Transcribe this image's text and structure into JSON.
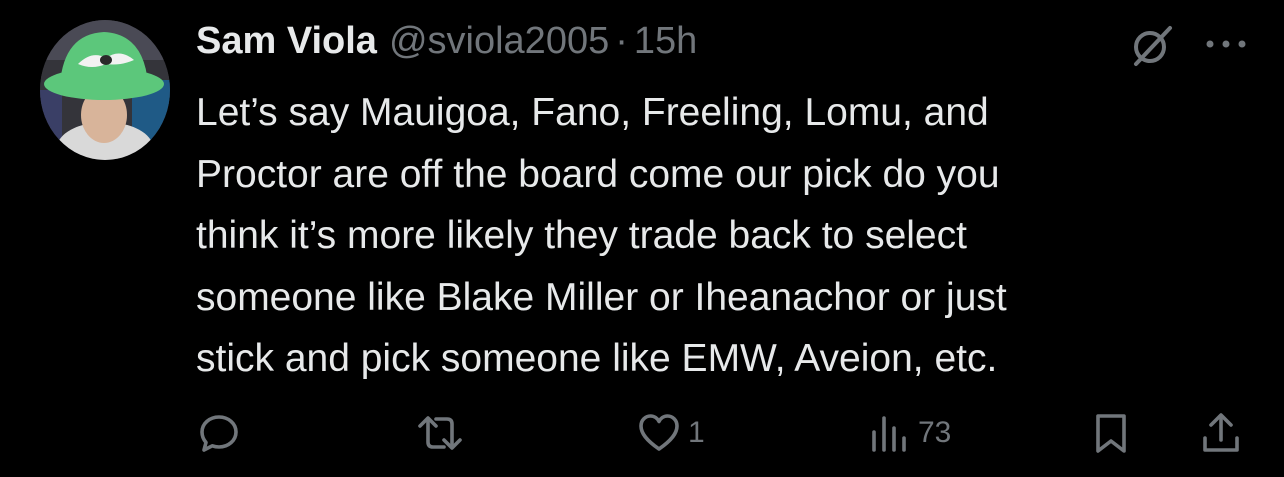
{
  "tweet": {
    "display_name": "Sam Viola",
    "handle": "@sviola2005",
    "separator": "·",
    "time": "15h",
    "text_lines": [
      "Let’s say Mauigoa, Fano, Freeling, Lomu, and",
      "Proctor are off the board come our pick do you",
      "think it’s more likely they trade back to select",
      "someone like Blake Miller or Iheanachor or just",
      "stick and pick someone like EMW, Aveion, etc."
    ]
  },
  "header_icons": {
    "grok": "grok-icon",
    "more": "more-icon"
  },
  "actions": {
    "reply": {
      "icon": "reply-icon",
      "count": ""
    },
    "retweet": {
      "icon": "retweet-icon",
      "count": ""
    },
    "like": {
      "icon": "heart-icon",
      "count": "1"
    },
    "views": {
      "icon": "views-icon",
      "count": "73"
    },
    "bookmark": {
      "icon": "bookmark-icon",
      "count": ""
    },
    "share": {
      "icon": "share-icon",
      "count": ""
    }
  },
  "colors": {
    "background": "#000000",
    "text_primary": "#e7e9ea",
    "text_secondary": "#71767b",
    "avatar_hat": "#5cc77b"
  }
}
